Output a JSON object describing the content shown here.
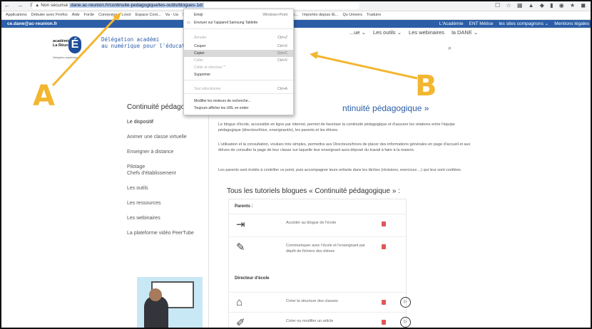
{
  "browser": {
    "nav_glyphs": "← → C",
    "security_label": "Non sécurisé",
    "url_selected": "dane.ac-reunion.fr/continuite-pedagogique/les-outils/blogues-1d/",
    "bookmarks": [
      "Applications",
      "Débuter avec Firefox",
      "Aide",
      "Forde",
      "Connexion",
      "Lovol",
      "Espace Cont...",
      "Va - Ua",
      "Se connecter à Solar",
      "https://www.dropb...",
      "Zandar - video con...",
      "Importés depuis IE...",
      "Qu Univers",
      "Traduire"
    ],
    "ext_glyphs": "☐ ☆ ▦ ▲ ◆ ▮ ◉ ★ ◼"
  },
  "site": {
    "email": "ce.dane@ac-reunion.fr",
    "top_links": [
      "L'Académie",
      "ENT Métice",
      "les sites compagnons ⌄",
      "Mentions légales"
    ],
    "logo_text": "académie\nLa Réunion",
    "logo_letter": "É",
    "logo_sub": "Délégation académique",
    "delegation": "Délégation académi\nau numérique pour l'éducat",
    "nav": [
      "...ue ⌄",
      "Les outils ⌄",
      "Les webinaires",
      "la DANE ⌄"
    ],
    "search_glyph": "⌕"
  },
  "left_nav": {
    "title": "Continuité pédagogique",
    "items": [
      "Le dispositif",
      "Animer une classe virtuelle",
      "Enseigner à distance",
      "Pilotage\nChefs d'établissement",
      "Les outils",
      "Les ressources",
      "Les webinaires",
      "La plateforme vidéo PeerTube"
    ]
  },
  "main": {
    "title": "ntinuité pédagogique »",
    "para1": "Le blogue d'école, accessible en ligne par internet, permet de favoriser la continuité pédagogique et d'assurer les relations entre l'équipe pédagogique (directeur/trice, enseignant/e), les parents et les élèves.",
    "para2": "L'utilisation et la consultation, voulues très simples, permettra aux Directeurs/trices de placer des informations générales en page d'accueil et aux élèves de consulter la page de leur classe sur laquelle leur enseignant aura déposé du travail à faire à la maison.",
    "para3": "Les parents sont invités à contrôler ce point, puis accompagner leurs enfants dans les tâches (révisions, exercices ...) qui leur sont confiées.",
    "tutorials_title": "Tous les tutoriels blogues « Continuité pédagogique » :",
    "groups": [
      "Parents :",
      "Directeur d'école"
    ],
    "rows": [
      {
        "icon": "⇥",
        "text": "Accéder au blogue de l'école"
      },
      {
        "icon": "✎",
        "text": "Communiquer avec l'école et l'enseignant par dépôt de fichiers des élèves"
      },
      {
        "icon": "⌂",
        "text": "Créer la structure des classes"
      },
      {
        "icon": "✐",
        "text": "Créer ou modifier un article"
      }
    ],
    "play_glyph": "▷"
  },
  "context_menu": {
    "items": [
      {
        "label": "Emoji",
        "shortcut": "Windows+Point",
        "state": "normal"
      },
      {
        "label": "Envoyer sur l'appareil Samsung Tablette",
        "shortcut": "",
        "state": "normal"
      },
      {
        "label": "Annuler",
        "shortcut": "Ctrl+Z",
        "state": "disabled"
      },
      {
        "label": "Couper",
        "shortcut": "Ctrl+X",
        "state": "normal"
      },
      {
        "label": "Copier",
        "shortcut": "Ctrl+C",
        "state": "hover"
      },
      {
        "label": "Coller",
        "shortcut": "Ctrl+V",
        "state": "disabled"
      },
      {
        "label": "Coller et chercher \"\"",
        "shortcut": "",
        "state": "disabled"
      },
      {
        "label": "Supprimer",
        "shortcut": "",
        "state": "normal"
      },
      {
        "label": "Tout sélectionner",
        "shortcut": "Ctrl+A",
        "state": "disabled"
      },
      {
        "label": "Modifier les moteurs de recherche...",
        "shortcut": "",
        "state": "normal"
      },
      {
        "label": "Toujours afficher les URL en entier",
        "shortcut": "",
        "state": "normal"
      }
    ]
  },
  "callouts": {
    "a": "A",
    "b": "B"
  },
  "colors": {
    "accent": "#f3b630",
    "brand": "#2b5ea7"
  }
}
